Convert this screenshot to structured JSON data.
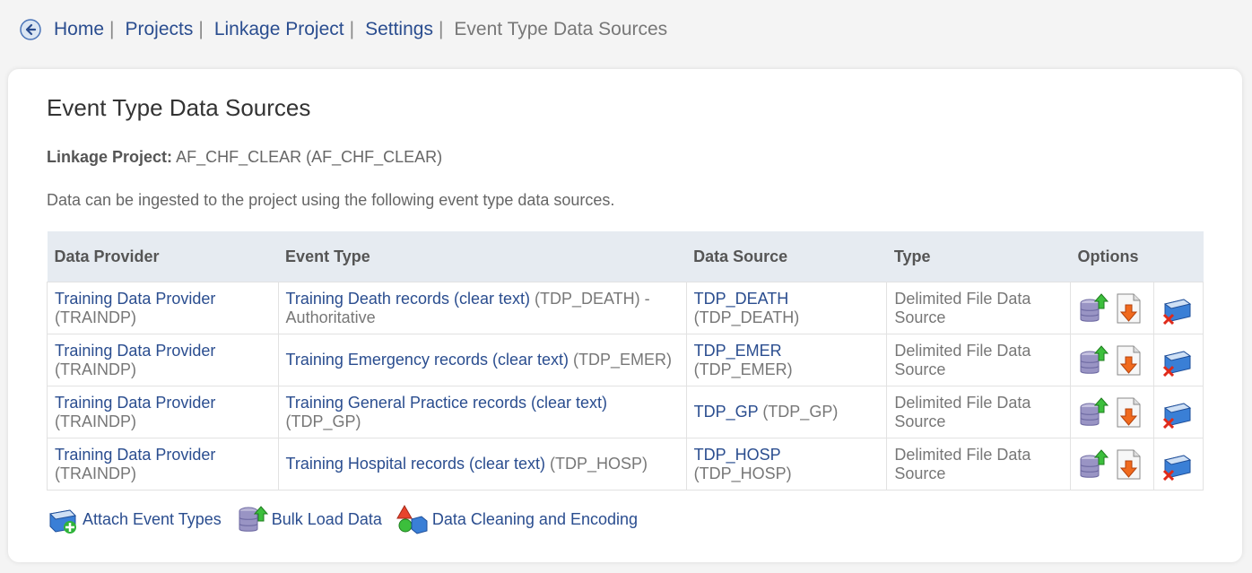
{
  "breadcrumb": {
    "items": [
      "Home",
      "Projects",
      "Linkage Project",
      "Settings"
    ],
    "separator": "|",
    "current": "Event Type Data Sources"
  },
  "page": {
    "title": "Event Type Data Sources",
    "project_label": "Linkage Project:",
    "project_value": "AF_CHF_CLEAR (AF_CHF_CLEAR)",
    "intro": "Data can be ingested to the project using the following event type data sources."
  },
  "table": {
    "headers": [
      "Data Provider",
      "Event Type",
      "Data Source",
      "Type",
      "Options"
    ],
    "rows": [
      {
        "provider": "Training Data Provider",
        "provider_code": "(TRAINDP)",
        "event_type": "Training Death records (clear text)",
        "event_code": "(TDP_DEATH) -",
        "event_note": "Authoritative",
        "source": "TDP_DEATH",
        "source_code": "(TDP_DEATH)",
        "type": "Delimited File Data Source"
      },
      {
        "provider": "Training Data Provider",
        "provider_code": "(TRAINDP)",
        "event_type": "Training Emergency records (clear text)",
        "event_code": "(TDP_EMER)",
        "event_note": "",
        "source": "TDP_EMER",
        "source_code": "(TDP_EMER)",
        "type": "Delimited File Data Source"
      },
      {
        "provider": "Training Data Provider",
        "provider_code": "(TRAINDP)",
        "event_type": "Training General Practice records (clear text)",
        "event_code": "(TDP_GP)",
        "event_note": "",
        "source": "TDP_GP",
        "source_code": "(TDP_GP)",
        "type": "Delimited File Data Source"
      },
      {
        "provider": "Training Data Provider",
        "provider_code": "(TRAINDP)",
        "event_type": "Training Hospital records (clear text)",
        "event_code": "(TDP_HOSP)",
        "event_note": "",
        "source": "TDP_HOSP",
        "source_code": "(TDP_HOSP)",
        "type": "Delimited File Data Source"
      }
    ],
    "option_icons": [
      "load-data-icon",
      "download-file-icon",
      "remove-data-source-icon"
    ]
  },
  "actions": {
    "attach": "Attach Event Types",
    "bulk": "Bulk Load Data",
    "cleaning": "Data Cleaning and Encoding"
  },
  "colors": {
    "link": "#2a4d8f",
    "header_bg": "#e6ebf1",
    "page_bg": "#f4f4f4"
  }
}
